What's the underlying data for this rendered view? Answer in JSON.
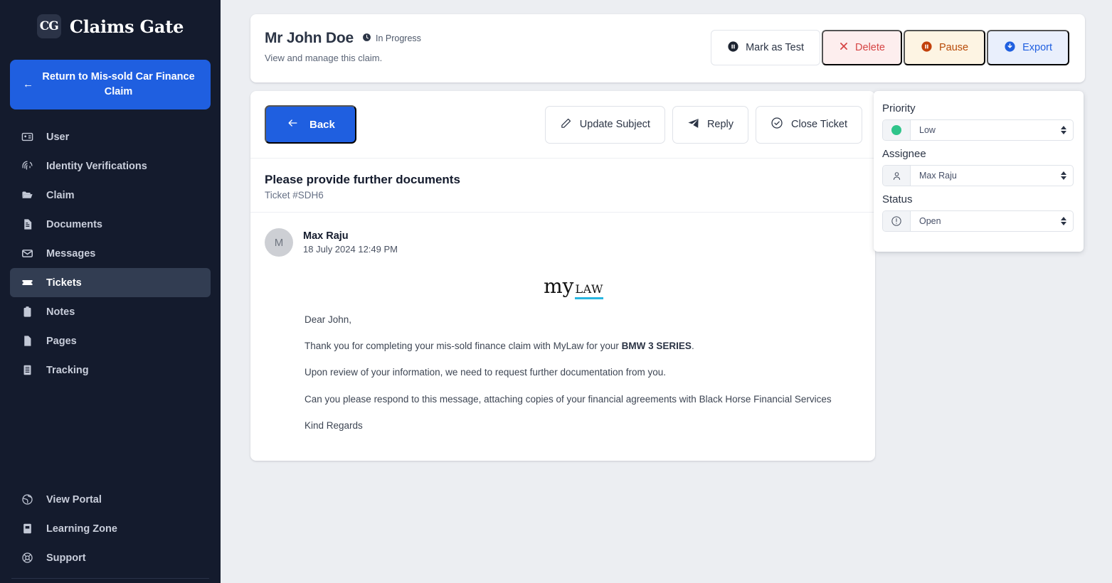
{
  "sidebar": {
    "brand": {
      "mark": "CG",
      "name": "Claims Gate"
    },
    "return_button": {
      "label": "Return to Mis-sold Car Finance Claim",
      "icon": "arrow-left-icon"
    },
    "items": [
      {
        "label": "User",
        "icon": "id-card-icon",
        "active": false
      },
      {
        "label": "Identity Verifications",
        "icon": "fingerprint-icon",
        "active": false
      },
      {
        "label": "Claim",
        "icon": "folder-icon",
        "active": false
      },
      {
        "label": "Documents",
        "icon": "document-icon",
        "active": false
      },
      {
        "label": "Messages",
        "icon": "envelope-icon",
        "active": false
      },
      {
        "label": "Tickets",
        "icon": "ticket-icon",
        "active": true
      },
      {
        "label": "Notes",
        "icon": "clipboard-icon",
        "active": false
      },
      {
        "label": "Pages",
        "icon": "page-icon",
        "active": false
      },
      {
        "label": "Tracking",
        "icon": "list-icon",
        "active": false
      }
    ],
    "bottom_items": [
      {
        "label": "View Portal",
        "icon": "globe-icon"
      },
      {
        "label": "Learning Zone",
        "icon": "book-icon"
      },
      {
        "label": "Support",
        "icon": "lifebuoy-icon"
      }
    ]
  },
  "header": {
    "title": "Mr John Doe",
    "status_badge": {
      "label": "In Progress",
      "icon": "clock-icon"
    },
    "subtitle": "View and manage this claim.",
    "actions": [
      {
        "label": "Mark as Test",
        "icon": "pause-circle-icon",
        "style": "outline"
      },
      {
        "label": "Delete",
        "icon": "x-icon",
        "style": "danger"
      },
      {
        "label": "Pause",
        "icon": "pause-circle-icon",
        "style": "warn"
      },
      {
        "label": "Export",
        "icon": "download-circle-icon",
        "style": "info"
      }
    ]
  },
  "ticket": {
    "back_button": {
      "label": "Back",
      "icon": "arrow-left-icon"
    },
    "toolbar_buttons": [
      {
        "label": "Update Subject",
        "icon": "pencil-icon"
      },
      {
        "label": "Reply",
        "icon": "paper-plane-icon"
      },
      {
        "label": "Close Ticket",
        "icon": "check-circle-icon"
      }
    ],
    "subject": "Please provide further documents",
    "reference": "Ticket #SDH6",
    "message": {
      "avatar_initial": "M",
      "author": "Max Raju",
      "timestamp": "18 July 2024 12:49 PM",
      "logo": {
        "primary": "my",
        "secondary": "LAW"
      },
      "paragraphs": [
        {
          "text": "Dear John,"
        },
        {
          "pre": "Thank you for completing your mis-sold finance claim with MyLaw for your ",
          "bold": "BMW 3 SERIES",
          "post": "."
        },
        {
          "text": "Upon review of your information, we need to request further documentation from you."
        },
        {
          "text": "Can you please respond to this message, attaching copies of your financial agreements with Black Horse Financial Services"
        },
        {
          "text": "Kind Regards"
        }
      ]
    }
  },
  "side_panel": {
    "priority": {
      "label": "Priority",
      "value": "Low",
      "icon": "priority-dot-icon",
      "dot_color": "#2fc48a"
    },
    "assignee": {
      "label": "Assignee",
      "value": "Max Raju",
      "icon": "user-icon"
    },
    "status": {
      "label": "Status",
      "value": "Open",
      "icon": "alert-circle-icon"
    }
  },
  "colors": {
    "brand_blue": "#1f5fe0",
    "sidebar_bg": "#141b2d",
    "page_bg": "#eceef2",
    "danger": "#d64545",
    "warn": "#b84a07",
    "success": "#2fc48a",
    "accent_cyan": "#29b6e0"
  }
}
